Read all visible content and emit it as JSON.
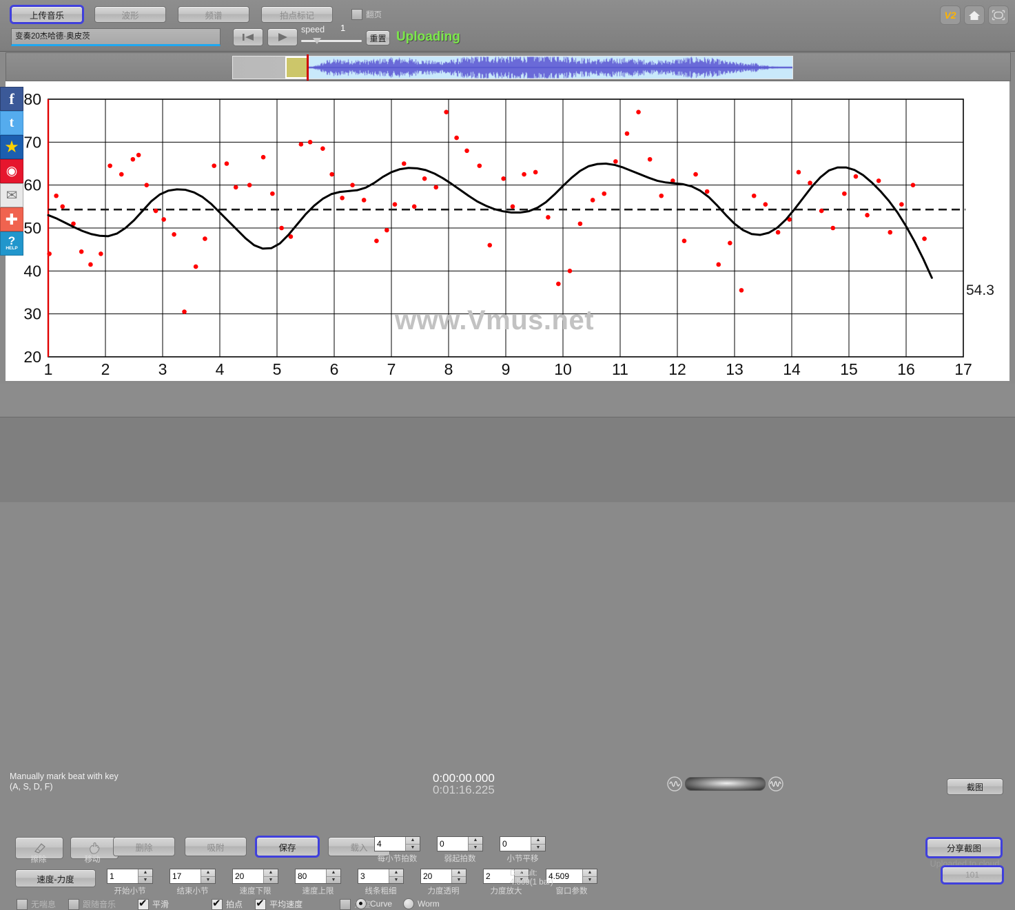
{
  "toolbar": {
    "tabs": [
      {
        "label": "上传音乐",
        "active": true
      },
      {
        "label": "波形",
        "active": false
      },
      {
        "label": "频谱",
        "active": false
      },
      {
        "label": "拍点标记",
        "active": false
      }
    ],
    "page_turn_label": "翻页",
    "page_turn_checked": false,
    "filename": "变奏20杰哈德·奥皮茨",
    "transport": {
      "rewind_icon": "skip-back-icon",
      "play_icon": "play-icon"
    },
    "speed_label": "speed",
    "speed_value": "1",
    "reset_label": "重置",
    "status": "Uploading",
    "status_color": "#7ce84b",
    "corner_icons": [
      {
        "name": "version-badge",
        "label": "V2"
      },
      {
        "name": "home-icon",
        "label": ""
      },
      {
        "name": "fullscreen-icon",
        "label": ""
      }
    ]
  },
  "sidebar": {
    "items": [
      {
        "name": "facebook-icon",
        "glyph": "f",
        "color": "#3b5998"
      },
      {
        "name": "twitter-icon",
        "glyph": "t",
        "color": "#55acee"
      },
      {
        "name": "qzone-icon",
        "glyph": "★",
        "color": "#1c5fb0"
      },
      {
        "name": "weibo-icon",
        "glyph": "◉",
        "color": "#e6162d"
      },
      {
        "name": "email-icon",
        "glyph": "✉",
        "color": "#e9e9e9"
      },
      {
        "name": "share-plus-icon",
        "glyph": "✚",
        "color": "#f0634f"
      },
      {
        "name": "help-icon",
        "glyph": "?",
        "color": "#2196cc",
        "caption": "HELP"
      }
    ]
  },
  "chart_data": {
    "type": "line",
    "title": "",
    "xlabel": "",
    "ylabel": "",
    "watermark": "www.Vmus.net",
    "xlim": [
      1,
      17
    ],
    "ylim": [
      20,
      80
    ],
    "xticks": [
      1,
      2,
      3,
      4,
      5,
      6,
      7,
      8,
      9,
      10,
      11,
      12,
      13,
      14,
      15,
      16,
      17
    ],
    "yticks": [
      20,
      30,
      40,
      50,
      60,
      70,
      80
    ],
    "grid": true,
    "mean_line": {
      "value": 54.3,
      "label": "54.3",
      "style": "dashed"
    },
    "series": [
      {
        "name": "tempo-curve",
        "type": "line",
        "color": "#000000",
        "width": 3,
        "x": [
          1.0,
          1.15,
          1.3,
          1.45,
          1.6,
          1.75,
          1.9,
          2.05,
          2.2,
          2.35,
          2.5,
          2.65,
          2.8,
          2.95,
          3.1,
          3.25,
          3.4,
          3.55,
          3.7,
          3.85,
          4.0,
          4.15,
          4.3,
          4.45,
          4.6,
          4.75,
          4.9,
          5.05,
          5.2,
          5.35,
          5.5,
          5.65,
          5.8,
          5.95,
          6.1,
          6.25,
          6.4,
          6.55,
          6.7,
          6.85,
          7.0,
          7.15,
          7.3,
          7.45,
          7.6,
          7.75,
          7.9,
          8.05,
          8.2,
          8.35,
          8.5,
          8.65,
          8.8,
          8.95,
          9.1,
          9.25,
          9.4,
          9.55,
          9.7,
          9.85,
          10.0,
          10.15,
          10.3,
          10.45,
          10.6,
          10.75,
          10.9,
          11.05,
          11.2,
          11.35,
          11.5,
          11.65,
          11.8,
          11.95,
          12.1,
          12.25,
          12.4,
          12.55,
          12.7,
          12.85,
          13.0,
          13.15,
          13.3,
          13.45,
          13.6,
          13.75,
          13.9,
          14.05,
          14.2,
          14.35,
          14.5,
          14.65,
          14.8,
          14.95,
          15.1,
          15.25,
          15.4,
          15.55,
          15.7,
          15.85,
          16.0,
          16.15,
          16.3,
          16.45
        ],
        "y": [
          53.0,
          52.2,
          51.2,
          50.2,
          49.3,
          48.6,
          48.2,
          48.1,
          48.7,
          50.0,
          51.8,
          54.0,
          56.2,
          57.8,
          58.7,
          59.0,
          58.9,
          58.3,
          57.2,
          55.6,
          53.6,
          51.6,
          49.6,
          47.6,
          46.0,
          45.2,
          45.3,
          46.4,
          48.4,
          50.8,
          53.2,
          55.2,
          56.8,
          57.9,
          58.4,
          58.6,
          58.8,
          59.4,
          60.5,
          61.9,
          63.0,
          63.7,
          64.0,
          63.9,
          63.5,
          62.7,
          61.6,
          60.3,
          58.9,
          57.5,
          56.2,
          55.2,
          54.4,
          53.9,
          53.6,
          53.6,
          53.9,
          54.7,
          56.0,
          57.8,
          59.8,
          61.7,
          63.3,
          64.4,
          64.9,
          65.0,
          64.7,
          64.1,
          63.3,
          62.5,
          61.7,
          61.0,
          60.6,
          60.4,
          60.2,
          59.7,
          58.7,
          57.2,
          55.2,
          53.0,
          51.0,
          49.5,
          48.6,
          48.4,
          48.9,
          50.1,
          52.0,
          54.4,
          57.0,
          59.6,
          61.8,
          63.4,
          64.1,
          64.1,
          63.5,
          62.3,
          60.6,
          58.6,
          56.3,
          53.6,
          50.4,
          46.8,
          42.8,
          38.4
        ]
      },
      {
        "name": "beat-points",
        "type": "scatter",
        "color": "#ff0000",
        "x": [
          1.02,
          1.14,
          1.25,
          1.44,
          1.58,
          1.74,
          1.92,
          2.08,
          2.28,
          2.48,
          2.58,
          2.72,
          2.88,
          3.02,
          3.2,
          3.38,
          3.58,
          3.74,
          3.9,
          4.12,
          4.28,
          4.52,
          4.76,
          4.92,
          5.08,
          5.24,
          5.42,
          5.58,
          5.8,
          5.96,
          6.14,
          6.32,
          6.52,
          6.74,
          6.92,
          7.06,
          7.22,
          7.4,
          7.58,
          7.78,
          7.96,
          8.14,
          8.32,
          8.54,
          8.72,
          8.96,
          9.12,
          9.32,
          9.52,
          9.74,
          9.92,
          10.12,
          10.3,
          10.52,
          10.72,
          10.92,
          11.12,
          11.32,
          11.52,
          11.72,
          11.92,
          12.12,
          12.32,
          12.52,
          12.72,
          12.92,
          13.12,
          13.34,
          13.54,
          13.76,
          13.96,
          14.12,
          14.32,
          14.52,
          14.72,
          14.92,
          15.12,
          15.32,
          15.52,
          15.72,
          15.92,
          16.12,
          16.32
        ],
        "y": [
          44.0,
          57.5,
          55.0,
          51.0,
          44.5,
          41.5,
          44.0,
          64.5,
          62.5,
          66.0,
          67.0,
          60.0,
          54.0,
          52.0,
          48.5,
          30.5,
          41.0,
          47.5,
          64.5,
          65.0,
          59.5,
          60.0,
          66.5,
          58.0,
          50.0,
          48.0,
          69.5,
          70.0,
          68.5,
          62.5,
          57.0,
          60.0,
          56.5,
          47.0,
          49.5,
          55.5,
          65.0,
          55.0,
          61.5,
          59.5,
          77.0,
          71.0,
          68.0,
          64.5,
          46.0,
          61.5,
          55.0,
          62.5,
          63.0,
          52.5,
          37.0,
          40.0,
          51.0,
          56.5,
          58.0,
          65.5,
          72.0,
          77.0,
          66.0,
          57.5,
          61.0,
          47.0,
          62.5,
          58.5,
          41.5,
          46.5,
          35.5,
          57.5,
          55.5,
          49.0,
          52.0,
          63.0,
          60.5,
          54.0,
          50.0,
          58.0,
          62.0,
          53.0,
          61.0,
          49.0,
          55.5,
          60.0,
          47.5
        ]
      }
    ]
  },
  "status_bar": {
    "hint_line1": "Manually mark beat with key",
    "hint_line2": "(A, S, D, F)",
    "time_current": "0:00:00.000",
    "time_total": "0:01:16.225",
    "screenshot_label": "截图"
  },
  "bottom_panel": {
    "tools": [
      {
        "name": "erase-tool",
        "icon": "eraser-icon",
        "caption": "擦除"
      },
      {
        "name": "move-tool",
        "icon": "hand-icon",
        "caption": "移动"
      }
    ],
    "actions": [
      {
        "label": "删除",
        "dim": true,
        "focus": false
      },
      {
        "label": "吸附",
        "dim": true,
        "focus": false
      },
      {
        "label": "保存",
        "dim": false,
        "focus": true
      },
      {
        "label": "载入",
        "dim": true,
        "focus": false
      }
    ],
    "spins_row1": [
      {
        "value": "4",
        "caption": "每小节拍数"
      },
      {
        "value": "0",
        "caption": "弱起拍数"
      },
      {
        "value": "0",
        "caption": "小节平移"
      }
    ],
    "tempo_dyn_label": "速度-力度",
    "spins_row2": [
      {
        "value": "1",
        "caption": "开始小节"
      },
      {
        "value": "17",
        "caption": "结束小节"
      },
      {
        "value": "20",
        "caption": "速度下限"
      },
      {
        "value": "80",
        "caption": "速度上限"
      },
      {
        "value": "3",
        "caption": "线条粗细"
      },
      {
        "value": "20",
        "caption": "力度透明"
      },
      {
        "value": "2",
        "caption": "力度放大"
      },
      {
        "value": "4.509",
        "caption": "窗口参数"
      }
    ],
    "default_line1": "Default:",
    "default_line2": "4.509(1 bar)",
    "checkboxes": [
      {
        "label": "无喘息",
        "checked": false
      },
      {
        "label": "跟随音乐",
        "checked": false
      },
      {
        "label": "平滑",
        "checked": true
      },
      {
        "label": "拍点",
        "checked": true
      },
      {
        "label": "平均速度",
        "checked": true
      },
      {
        "label": "力度",
        "checked": false
      }
    ],
    "radios": [
      {
        "label": "Curve",
        "selected": true
      },
      {
        "label": "Worm",
        "selected": false
      }
    ],
    "share_label": "分享截图",
    "cloud_text": "Uploaded to cloud",
    "cloud_count": "101"
  }
}
